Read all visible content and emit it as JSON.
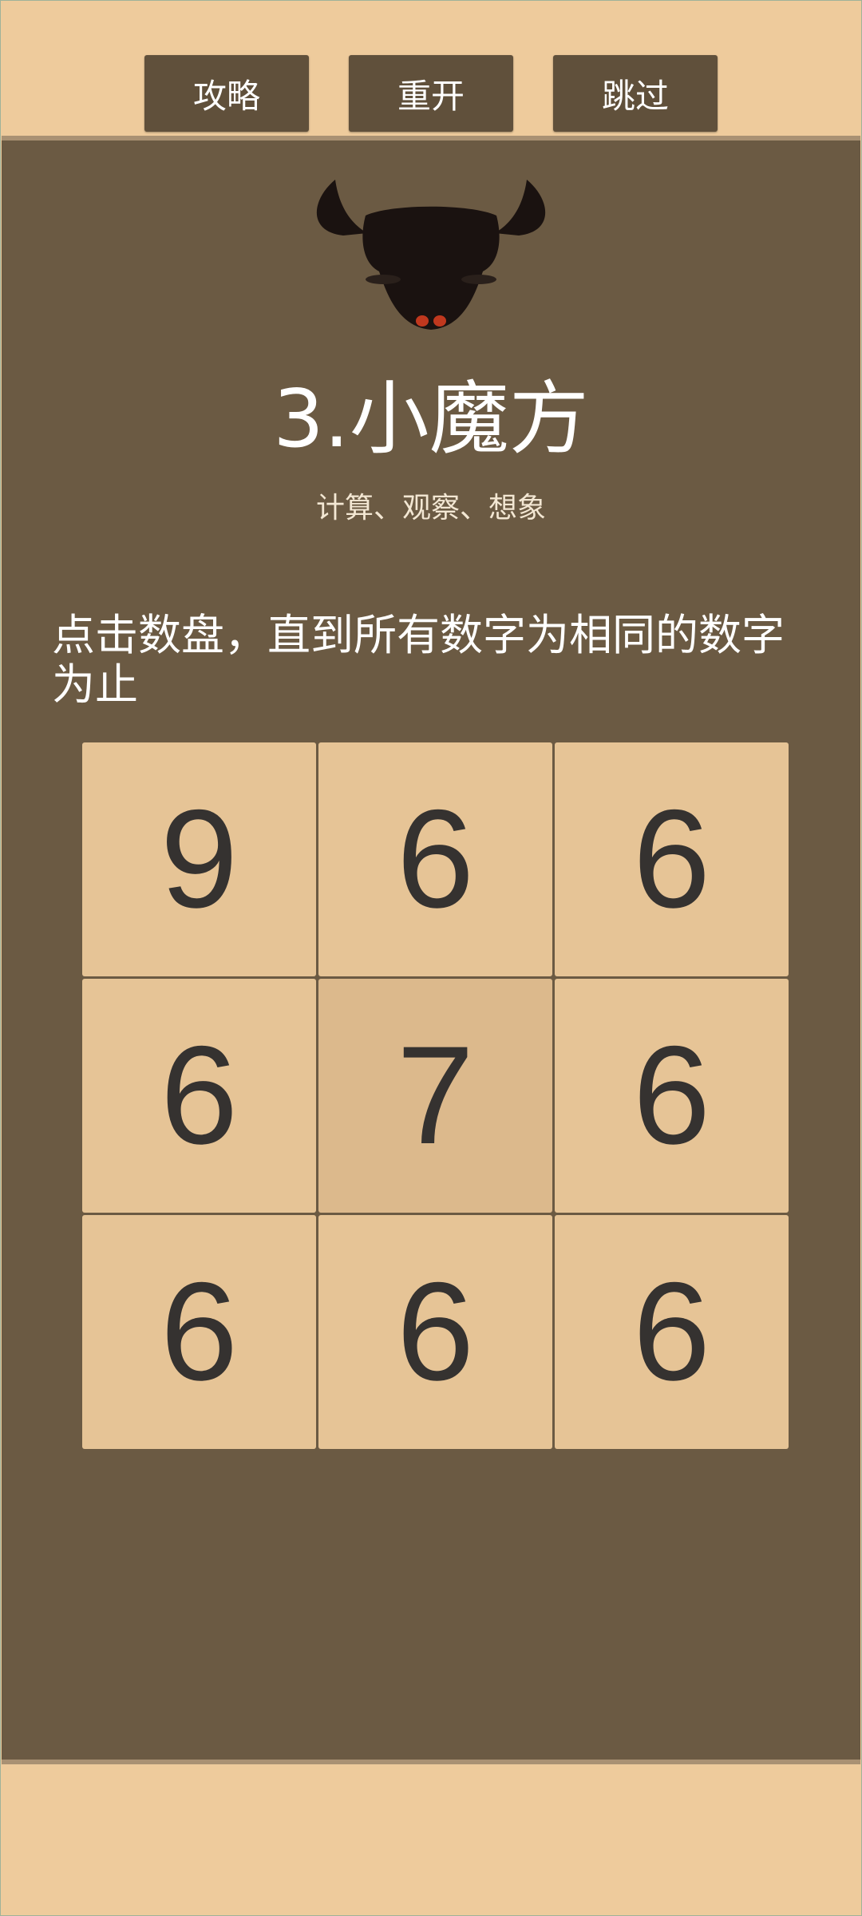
{
  "toolbar": {
    "guide_label": "攻略",
    "restart_label": "重开",
    "skip_label": "跳过"
  },
  "level": {
    "title": "3.小魔方",
    "subtitle": "计算、观察、想象",
    "instruction": "点击数盘，直到所有数字为相同的数字为止"
  },
  "board": {
    "cells": [
      "9",
      "6",
      "6",
      "6",
      "7",
      "6",
      "6",
      "6",
      "6"
    ]
  },
  "colors": {
    "page_bg": "#eecb9c",
    "panel_bg": "#6b5a43",
    "button_bg": "#60503b",
    "cell_bg": "#e6c496",
    "cell_active_bg": "#dcb98c",
    "digit": "#353230"
  },
  "icons": {
    "logo": "bull-head-icon"
  }
}
